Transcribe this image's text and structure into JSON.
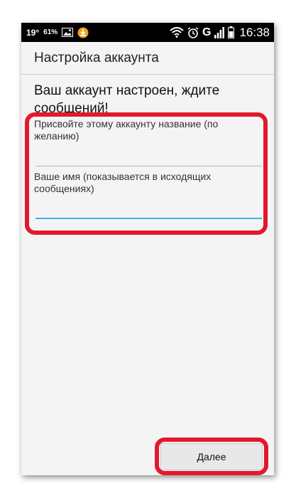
{
  "status_bar": {
    "temperature": "19°",
    "battery_percent": "61%",
    "network": "G",
    "time": "16:38"
  },
  "header": {
    "title": "Настройка аккаунта"
  },
  "main": {
    "heading": "Ваш аккаунт настроен, ждите сообщений!",
    "account_name_label": "Присвойте этому аккаунту название (по желанию)",
    "account_name_value": "",
    "your_name_label": "Ваше имя (показывается в исходящих сообщениях)",
    "your_name_value": ""
  },
  "footer": {
    "next_label": "Далее"
  },
  "colors": {
    "status_bar": "#000000",
    "background": "#f4f4f4",
    "accent": "#33b5e5",
    "highlight": "#e3182d"
  }
}
